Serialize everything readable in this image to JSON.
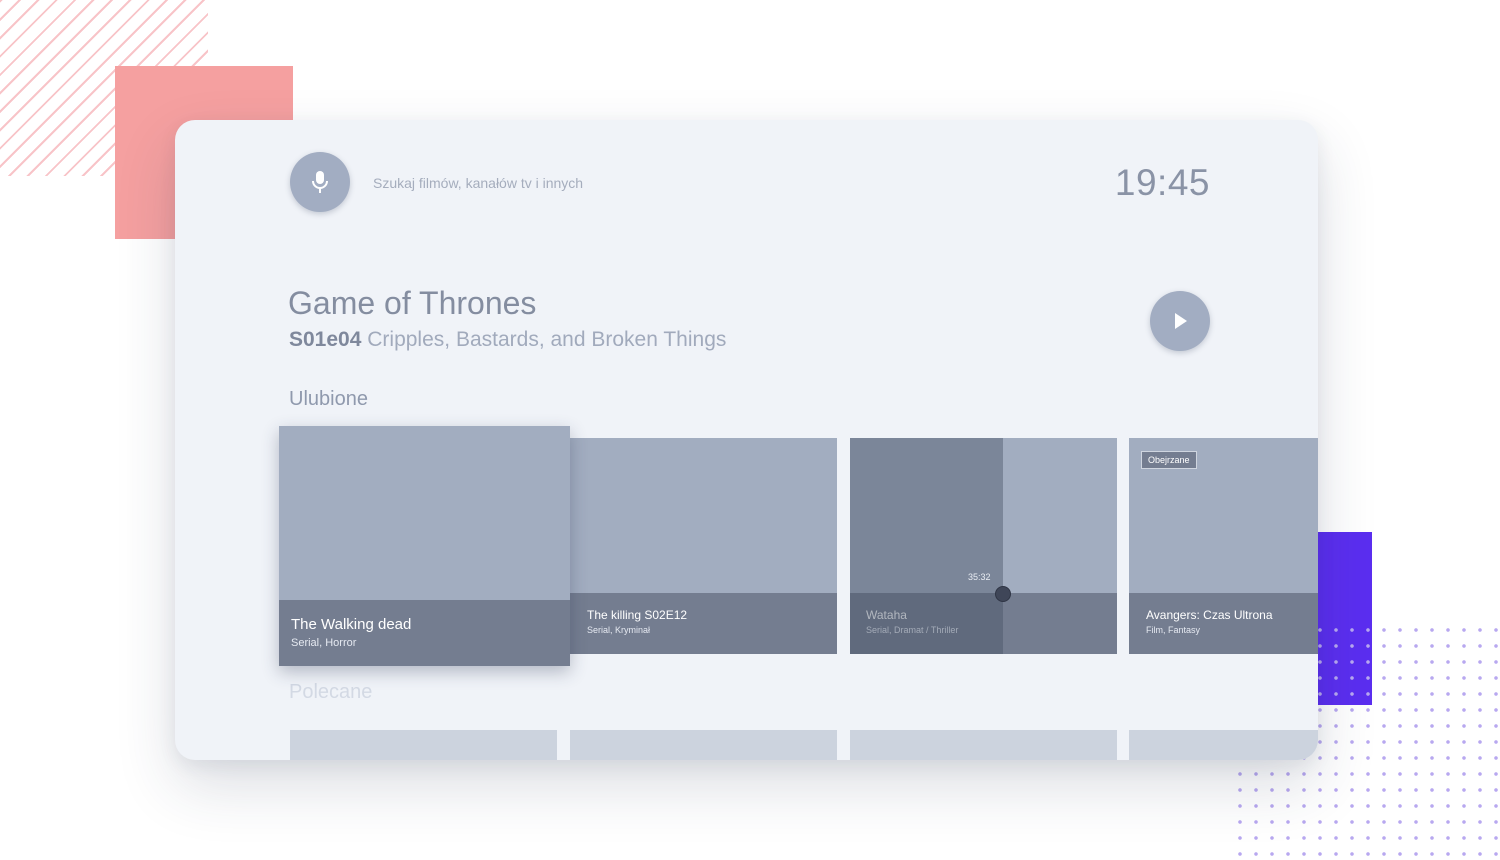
{
  "search": {
    "placeholder": "Szukaj filmów, kanałów tv i innych",
    "icon": "microphone-icon"
  },
  "clock": {
    "time": "19:45"
  },
  "featured": {
    "title": "Game of Thrones",
    "episode_code": "S01e04",
    "episode_title": "Cripples, Bastards, and Broken Things",
    "play_icon": "play-icon"
  },
  "sections": {
    "favorites": {
      "title": "Ulubione",
      "items": [
        {
          "title": "The Walking dead",
          "genres": "Serial, Horror"
        },
        {
          "title": "The killing S02E12",
          "genres": "Serial, Kryminał"
        },
        {
          "title": "Wataha",
          "genres": "Serial, Dramat / Thriller",
          "time": "35:32"
        },
        {
          "title": "Avangers: Czas Ultrona",
          "genres": "Film, Fantasy",
          "badge": "Obejrzane"
        }
      ]
    },
    "recommended": {
      "title": "Polecane"
    }
  },
  "colors": {
    "card_background": "#f0f3f8",
    "tile": "#a2adc0",
    "caption": "#747d90",
    "accent_pink": "#f5a0a0",
    "accent_purple": "#5b2ef0"
  }
}
